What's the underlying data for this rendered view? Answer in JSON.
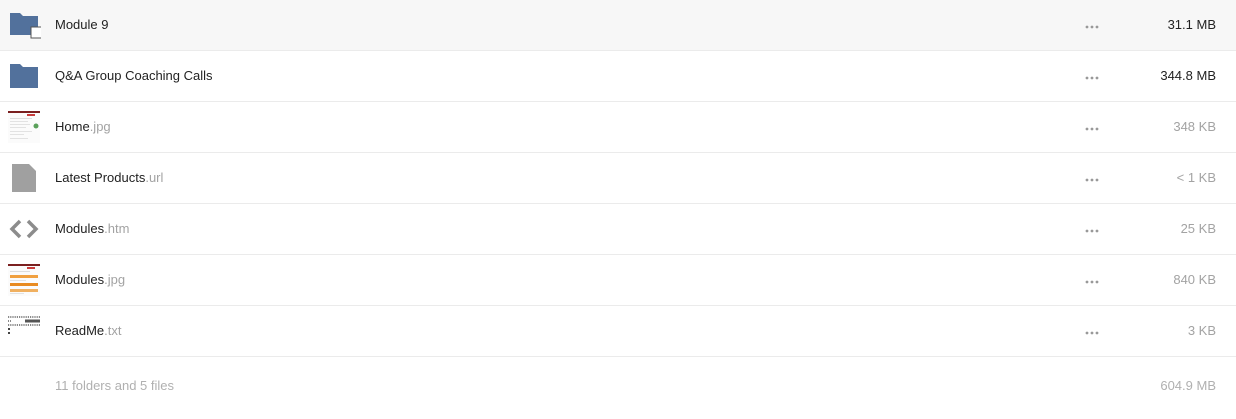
{
  "colors": {
    "folder": "#52719c",
    "generic_file": "#a0a0a0",
    "code_icon": "#8c8c8c",
    "divider": "#ebebeb",
    "muted_text": "#a3a3a3"
  },
  "files": [
    {
      "name": "Module 9",
      "ext": "",
      "size": "31.1 MB",
      "icon": "folder-icon",
      "selected": true
    },
    {
      "name": "Q&A Group Coaching Calls",
      "ext": "",
      "size": "344.8 MB",
      "icon": "folder-icon"
    },
    {
      "name": "Home",
      "ext": ".jpg",
      "size": "348 KB",
      "icon": "image-thumbnail"
    },
    {
      "name": "Latest Products",
      "ext": ".url",
      "size": "< 1 KB",
      "icon": "generic-file-icon"
    },
    {
      "name": "Modules",
      "ext": ".htm",
      "size": "25 KB",
      "icon": "code-icon"
    },
    {
      "name": "Modules",
      "ext": ".jpg",
      "size": "840 KB",
      "icon": "image-thumbnail"
    },
    {
      "name": "ReadMe",
      "ext": ".txt",
      "size": "3 KB",
      "icon": "text-file-thumbnail"
    }
  ],
  "summary": {
    "count_text": "11 folders and 5 files",
    "total_size": "604.9 MB"
  },
  "more_icon": "more-horizontal-icon"
}
